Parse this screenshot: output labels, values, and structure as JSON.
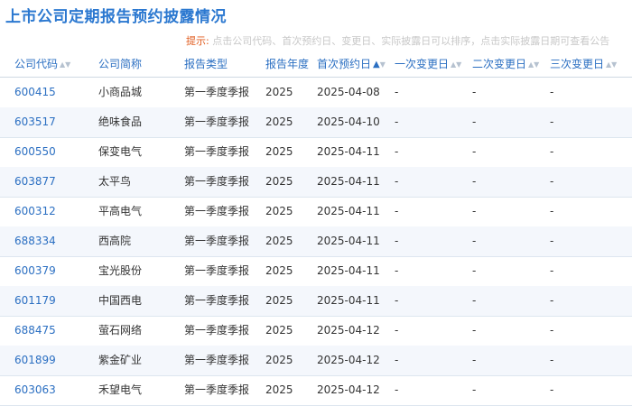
{
  "page": {
    "title": "上市公司定期报告预约披露情况",
    "tip_label": "提示:",
    "tip_text": "点击公司代码、首次预约日、变更日、实际披露日可以排序，点击实际披露日期可查看公告"
  },
  "table": {
    "columns": [
      {
        "label": "公司代码",
        "sortable": true,
        "sort": "none"
      },
      {
        "label": "公司简称",
        "sortable": false
      },
      {
        "label": "报告类型",
        "sortable": false
      },
      {
        "label": "报告年度",
        "sortable": false
      },
      {
        "label": "首次预约日",
        "sortable": true,
        "sort": "asc"
      },
      {
        "label": "一次变更日",
        "sortable": true,
        "sort": "none"
      },
      {
        "label": "二次变更日",
        "sortable": true,
        "sort": "none"
      },
      {
        "label": "三次变更日",
        "sortable": true,
        "sort": "none"
      }
    ],
    "sort_arrows": {
      "up": "▲",
      "down": "▼"
    },
    "rows": [
      {
        "code": "600415",
        "name": "小商品城",
        "type": "第一季度季报",
        "year": "2025",
        "first": "2025-04-08",
        "change1": "-",
        "change2": "-",
        "change3": "-"
      },
      {
        "code": "603517",
        "name": "绝味食品",
        "type": "第一季度季报",
        "year": "2025",
        "first": "2025-04-10",
        "change1": "-",
        "change2": "-",
        "change3": "-"
      },
      {
        "code": "600550",
        "name": "保变电气",
        "type": "第一季度季报",
        "year": "2025",
        "first": "2025-04-11",
        "change1": "-",
        "change2": "-",
        "change3": "-"
      },
      {
        "code": "603877",
        "name": "太平鸟",
        "type": "第一季度季报",
        "year": "2025",
        "first": "2025-04-11",
        "change1": "-",
        "change2": "-",
        "change3": "-"
      },
      {
        "code": "600312",
        "name": "平高电气",
        "type": "第一季度季报",
        "year": "2025",
        "first": "2025-04-11",
        "change1": "-",
        "change2": "-",
        "change3": "-"
      },
      {
        "code": "688334",
        "name": "西高院",
        "type": "第一季度季报",
        "year": "2025",
        "first": "2025-04-11",
        "change1": "-",
        "change2": "-",
        "change3": "-"
      },
      {
        "code": "600379",
        "name": "宝光股份",
        "type": "第一季度季报",
        "year": "2025",
        "first": "2025-04-11",
        "change1": "-",
        "change2": "-",
        "change3": "-"
      },
      {
        "code": "601179",
        "name": "中国西电",
        "type": "第一季度季报",
        "year": "2025",
        "first": "2025-04-11",
        "change1": "-",
        "change2": "-",
        "change3": "-"
      },
      {
        "code": "688475",
        "name": "萤石网络",
        "type": "第一季度季报",
        "year": "2025",
        "first": "2025-04-12",
        "change1": "-",
        "change2": "-",
        "change3": "-"
      },
      {
        "code": "601899",
        "name": "紫金矿业",
        "type": "第一季度季报",
        "year": "2025",
        "first": "2025-04-12",
        "change1": "-",
        "change2": "-",
        "change3": "-"
      },
      {
        "code": "603063",
        "name": "禾望电气",
        "type": "第一季度季报",
        "year": "2025",
        "first": "2025-04-12",
        "change1": "-",
        "change2": "-",
        "change3": "-"
      }
    ]
  }
}
